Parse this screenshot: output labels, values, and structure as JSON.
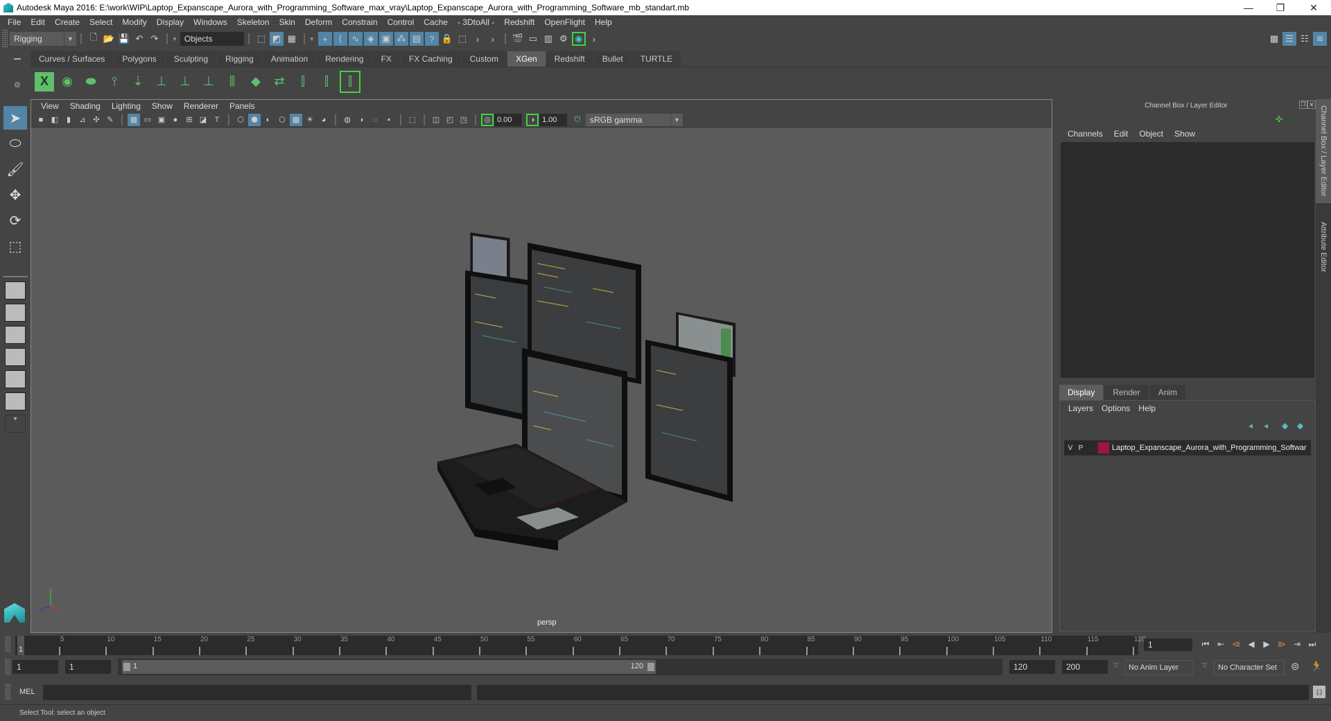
{
  "window": {
    "title": "Autodesk Maya 2016: E:\\work\\WIP\\Laptop_Expanscape_Aurora_with_Programming_Software_max_vray\\Laptop_Expanscape_Aurora_with_Programming_Software_mb_standart.mb",
    "controls": {
      "minimize": "—",
      "restore": "❐",
      "close": "✕"
    }
  },
  "menubar": [
    "File",
    "Edit",
    "Create",
    "Select",
    "Modify",
    "Display",
    "Windows",
    "Skeleton",
    "Skin",
    "Deform",
    "Constrain",
    "Control",
    "Cache",
    "- 3DtoAll -",
    "Redshift",
    "OpenFlight",
    "Help"
  ],
  "statusline": {
    "mode": "Rigging",
    "selection_mask": "Objects"
  },
  "shelf": {
    "tabs": [
      "Curves / Surfaces",
      "Polygons",
      "Sculpting",
      "Rigging",
      "Animation",
      "Rendering",
      "FX",
      "FX Caching",
      "Custom",
      "XGen",
      "Redshift",
      "Bullet",
      "TURTLE"
    ],
    "active_tab": "XGen",
    "icons": [
      "xgen-editor-icon",
      "create-description-icon",
      "delete-description-icon",
      "add-guides-icon",
      "place-guides-icon",
      "add-guide-icon",
      "sculpt-guide-icon",
      "lock-guide-icon",
      "guides-to-curves-icon",
      "cvs-icon",
      "flip-guide-icon",
      "select-guide-icon",
      "rebuild-guide-icon",
      "toggle-guide-icon"
    ]
  },
  "viewport": {
    "menu": [
      "View",
      "Shading",
      "Lighting",
      "Show",
      "Renderer",
      "Panels"
    ],
    "exposure": "0.00",
    "gamma": "1.00",
    "color_space": "sRGB gamma",
    "camera": "persp"
  },
  "channel_box": {
    "title": "Channel Box / Layer Editor",
    "menu": [
      "Channels",
      "Edit",
      "Object",
      "Show"
    ]
  },
  "layer_editor": {
    "tabs": [
      "Display",
      "Render",
      "Anim"
    ],
    "active_tab": "Display",
    "menu": [
      "Layers",
      "Options",
      "Help"
    ],
    "layers": [
      {
        "v": "V",
        "p": "P",
        "color": "#a0163a",
        "name": "Laptop_Expanscape_Aurora_with_Programming_Softwar"
      }
    ]
  },
  "side_tabs": [
    "Channel Box / Layer Editor",
    "Attribute Editor"
  ],
  "timeline": {
    "start": 1,
    "end": 120,
    "current_frame": "1",
    "tick_labels": [
      5,
      10,
      15,
      20,
      25,
      30,
      35,
      40,
      45,
      50,
      55,
      60,
      65,
      70,
      75,
      80,
      85,
      90,
      95,
      100,
      105,
      110,
      115,
      120
    ]
  },
  "range": {
    "start_time": "1",
    "playback_start": "1",
    "slider_start": "1",
    "slider_end": "120",
    "playback_end": "120",
    "end_time": "200",
    "anim_layer": "No Anim Layer",
    "character_set": "No Character Set"
  },
  "command_line": {
    "label": "MEL"
  },
  "help_line": "Select Tool: select an object"
}
